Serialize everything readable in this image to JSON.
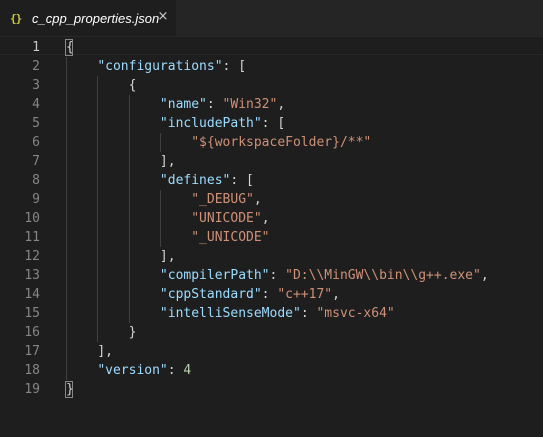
{
  "tab": {
    "icon": "{}",
    "title": "c_cpp_properties.json",
    "close": "×"
  },
  "editor": {
    "lines": [
      {
        "num": "1",
        "indent": "",
        "tokens": [
          [
            "punc",
            "{"
          ]
        ]
      },
      {
        "num": "2",
        "indent": "    ",
        "tokens": [
          [
            "key",
            "\"configurations\""
          ],
          [
            "punc",
            ": ["
          ]
        ]
      },
      {
        "num": "3",
        "indent": "        ",
        "tokens": [
          [
            "punc",
            "{"
          ]
        ]
      },
      {
        "num": "4",
        "indent": "            ",
        "tokens": [
          [
            "key",
            "\"name\""
          ],
          [
            "punc",
            ": "
          ],
          [
            "str",
            "\"Win32\""
          ],
          [
            "punc",
            ","
          ]
        ]
      },
      {
        "num": "5",
        "indent": "            ",
        "tokens": [
          [
            "key",
            "\"includePath\""
          ],
          [
            "punc",
            ": ["
          ]
        ]
      },
      {
        "num": "6",
        "indent": "                ",
        "tokens": [
          [
            "str",
            "\"${workspaceFolder}/**\""
          ]
        ]
      },
      {
        "num": "7",
        "indent": "            ",
        "tokens": [
          [
            "punc",
            "],"
          ]
        ]
      },
      {
        "num": "8",
        "indent": "            ",
        "tokens": [
          [
            "key",
            "\"defines\""
          ],
          [
            "punc",
            ": ["
          ]
        ]
      },
      {
        "num": "9",
        "indent": "                ",
        "tokens": [
          [
            "str",
            "\"_DEBUG\""
          ],
          [
            "punc",
            ","
          ]
        ]
      },
      {
        "num": "10",
        "indent": "                ",
        "tokens": [
          [
            "str",
            "\"UNICODE\""
          ],
          [
            "punc",
            ","
          ]
        ]
      },
      {
        "num": "11",
        "indent": "                ",
        "tokens": [
          [
            "str",
            "\"_UNICODE\""
          ]
        ]
      },
      {
        "num": "12",
        "indent": "            ",
        "tokens": [
          [
            "punc",
            "],"
          ]
        ]
      },
      {
        "num": "13",
        "indent": "            ",
        "tokens": [
          [
            "key",
            "\"compilerPath\""
          ],
          [
            "punc",
            ": "
          ],
          [
            "str",
            "\"D:\\\\MinGW\\\\bin\\\\g++.exe\""
          ],
          [
            "punc",
            ","
          ]
        ]
      },
      {
        "num": "14",
        "indent": "            ",
        "tokens": [
          [
            "key",
            "\"cppStandard\""
          ],
          [
            "punc",
            ": "
          ],
          [
            "str",
            "\"c++17\""
          ],
          [
            "punc",
            ","
          ]
        ]
      },
      {
        "num": "15",
        "indent": "            ",
        "tokens": [
          [
            "key",
            "\"intelliSenseMode\""
          ],
          [
            "punc",
            ": "
          ],
          [
            "str",
            "\"msvc-x64\""
          ]
        ]
      },
      {
        "num": "16",
        "indent": "        ",
        "tokens": [
          [
            "punc",
            "}"
          ]
        ]
      },
      {
        "num": "17",
        "indent": "    ",
        "tokens": [
          [
            "punc",
            "],"
          ]
        ]
      },
      {
        "num": "18",
        "indent": "    ",
        "tokens": [
          [
            "key",
            "\"version\""
          ],
          [
            "punc",
            ": "
          ],
          [
            "num",
            "4"
          ]
        ]
      },
      {
        "num": "19",
        "indent": "",
        "tokens": [
          [
            "punc",
            "}"
          ]
        ]
      }
    ],
    "active_line": "1"
  },
  "colors": {
    "background": "#1e1e1e",
    "tab_bar": "#252526",
    "json_key": "#9cdcfe",
    "json_string": "#ce9178",
    "json_number": "#b5cea8",
    "line_number": "#858585"
  }
}
